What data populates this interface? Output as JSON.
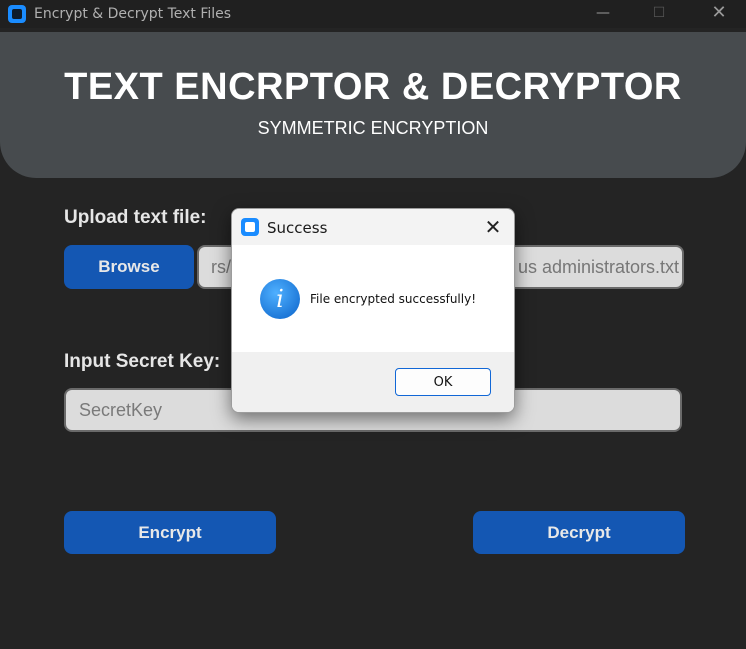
{
  "window": {
    "title": "Encrypt & Decrypt Text Files",
    "minimize_glyph": "—",
    "maximize_glyph": "☐",
    "close_glyph": "✕"
  },
  "header": {
    "title": "TEXT ENCRPTOR & DECRYPTOR",
    "subtitle": "SYMMETRIC ENCRYPTION"
  },
  "upload": {
    "label": "Upload text file:",
    "browse_label": "Browse",
    "file_path_left": "rs/",
    "file_path_right": "us administrators.txt"
  },
  "key": {
    "label": "Input Secret Key:",
    "placeholder": "SecretKey"
  },
  "actions": {
    "encrypt_label": "Encrypt",
    "decrypt_label": "Decrypt"
  },
  "dialog": {
    "title": "Success",
    "close_glyph": "✕",
    "icon_glyph": "i",
    "message": "File encrypted successfully!",
    "ok_label": "OK"
  },
  "colors": {
    "background": "#242424",
    "banner": "#474b4e",
    "button": "#1457b3",
    "field": "#dcdcdc",
    "accent": "#1a8cff"
  },
  "icons": {
    "app": "app-icon",
    "info": "info-icon"
  }
}
